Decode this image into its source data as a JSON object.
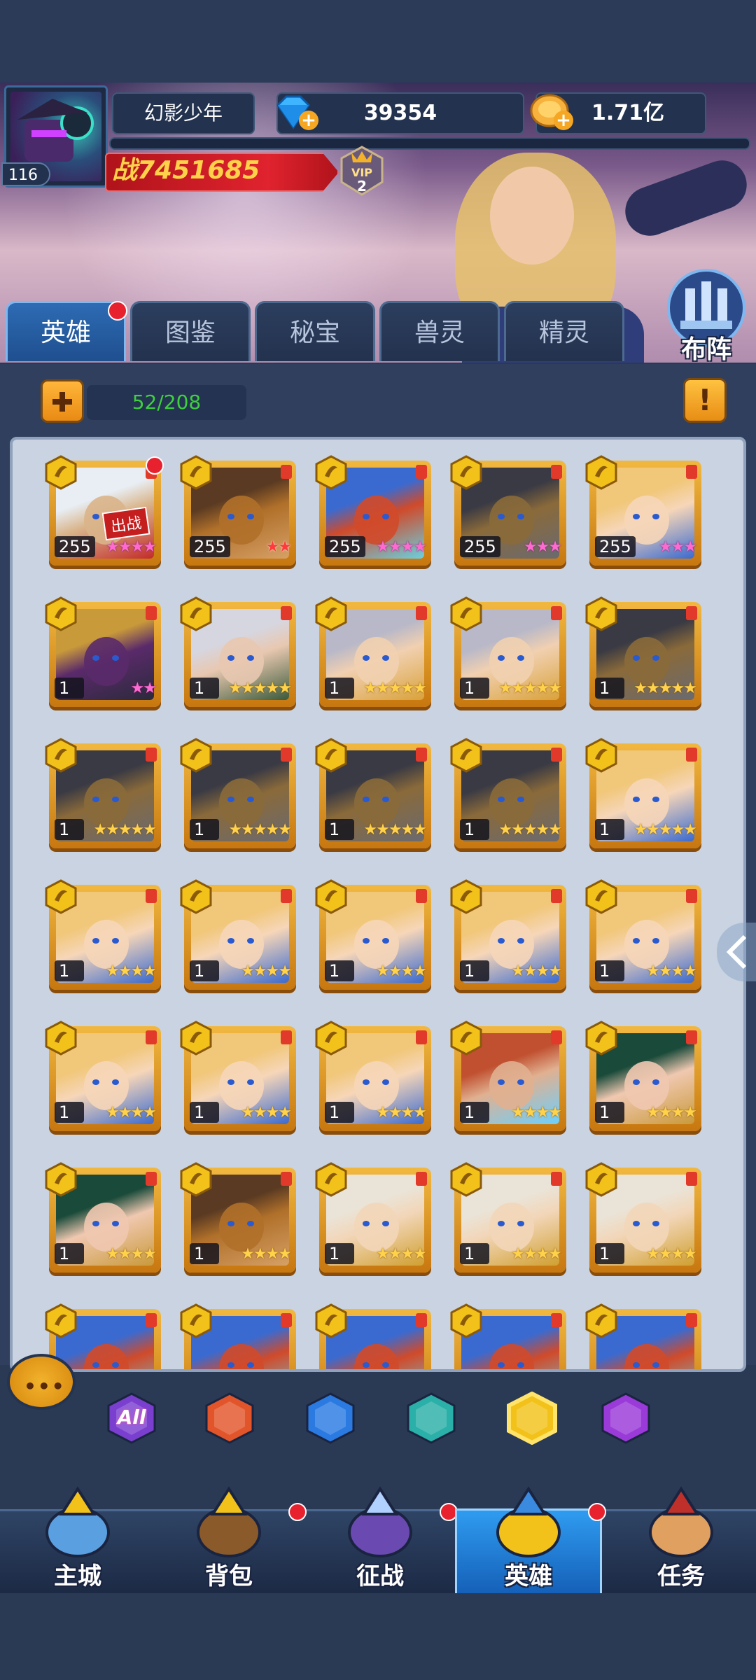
{
  "player": {
    "name": "幻影少年",
    "level": "116",
    "diamonds": "39354",
    "gold": "1.71亿",
    "power": "战7451685",
    "vip": "2"
  },
  "lineup_button": "布阵",
  "tabs": [
    {
      "label": "英雄",
      "active": true,
      "dot": true
    },
    {
      "label": "图鉴",
      "active": false
    },
    {
      "label": "秘宝",
      "active": false
    },
    {
      "label": "兽灵",
      "active": false
    },
    {
      "label": "精灵",
      "active": false
    }
  ],
  "hero_count": "52/208",
  "heroes": [
    {
      "level": "255",
      "stars": "★★★★",
      "star_color": "pink",
      "deployed": true,
      "deploy_label": "出战",
      "dot": true,
      "art": "white-hair"
    },
    {
      "level": "255",
      "stars": "★★",
      "star_color": "red",
      "art": "hooded-brown"
    },
    {
      "level": "255",
      "stars": "★★★★",
      "star_color": "pink",
      "art": "blue-troll"
    },
    {
      "level": "255",
      "stars": "★★★",
      "star_color": "pink",
      "art": "dark-hood"
    },
    {
      "level": "255",
      "stars": "★★★",
      "star_color": "pink",
      "art": "blonde-girl"
    },
    {
      "level": "1",
      "stars": "★★",
      "star_color": "pink",
      "art": "gold-mask"
    },
    {
      "level": "1",
      "stars": "★★★★★",
      "star_color": "gold",
      "art": "silver-hair"
    },
    {
      "level": "1",
      "stars": "★★★★★",
      "star_color": "gold",
      "art": "helmet-girl"
    },
    {
      "level": "1",
      "stars": "★★★★★",
      "star_color": "gold",
      "art": "helmet-girl"
    },
    {
      "level": "1",
      "stars": "★★★★★",
      "star_color": "gold",
      "art": "dark-hood"
    },
    {
      "level": "1",
      "stars": "★★★★★",
      "star_color": "gold",
      "art": "dark-hood"
    },
    {
      "level": "1",
      "stars": "★★★★★",
      "star_color": "gold",
      "art": "dark-hood"
    },
    {
      "level": "1",
      "stars": "★★★★★",
      "star_color": "gold",
      "art": "dark-hood"
    },
    {
      "level": "1",
      "stars": "★★★★★",
      "star_color": "gold",
      "art": "dark-hood"
    },
    {
      "level": "1",
      "stars": "★★★★★",
      "star_color": "gold",
      "art": "blonde-girl"
    },
    {
      "level": "1",
      "stars": "★★★★",
      "star_color": "gold",
      "art": "blonde-girl"
    },
    {
      "level": "1",
      "stars": "★★★★",
      "star_color": "gold",
      "art": "blonde-girl"
    },
    {
      "level": "1",
      "stars": "★★★★",
      "star_color": "gold",
      "art": "blonde-girl"
    },
    {
      "level": "1",
      "stars": "★★★★",
      "star_color": "gold",
      "art": "blonde-girl"
    },
    {
      "level": "1",
      "stars": "★★★★",
      "star_color": "gold",
      "art": "blonde-girl"
    },
    {
      "level": "1",
      "stars": "★★★★",
      "star_color": "gold",
      "art": "blonde-girl"
    },
    {
      "level": "1",
      "stars": "★★★★",
      "star_color": "gold",
      "art": "blonde-girl"
    },
    {
      "level": "1",
      "stars": "★★★★",
      "star_color": "gold",
      "art": "blonde-girl"
    },
    {
      "level": "1",
      "stars": "★★★★",
      "star_color": "gold",
      "art": "bearded-man"
    },
    {
      "level": "1",
      "stars": "★★★★",
      "star_color": "gold",
      "art": "green-hair"
    },
    {
      "level": "1",
      "stars": "★★★★",
      "star_color": "gold",
      "art": "green-hair"
    },
    {
      "level": "1",
      "stars": "★★★★",
      "star_color": "gold",
      "art": "hooded-brown"
    },
    {
      "level": "1",
      "stars": "★★★★",
      "star_color": "gold",
      "art": "white-knight"
    },
    {
      "level": "1",
      "stars": "★★★★",
      "star_color": "gold",
      "art": "white-knight"
    },
    {
      "level": "1",
      "stars": "★★★★",
      "star_color": "gold",
      "art": "white-knight"
    },
    {
      "level": "",
      "stars": "",
      "star_color": "gold",
      "art": "blue-troll"
    },
    {
      "level": "",
      "stars": "",
      "star_color": "gold",
      "art": "blue-troll"
    },
    {
      "level": "",
      "stars": "",
      "star_color": "gold",
      "art": "blue-troll"
    },
    {
      "level": "",
      "stars": "",
      "star_color": "gold",
      "art": "blue-troll"
    },
    {
      "level": "",
      "stars": "",
      "star_color": "gold",
      "art": "blue-troll"
    }
  ],
  "filters": [
    {
      "name": "all-filter-icon",
      "label": "All",
      "color": "#7b3fd0"
    },
    {
      "name": "fire-faction-icon",
      "label": "",
      "color": "#e2552a"
    },
    {
      "name": "water-faction-icon",
      "label": "",
      "color": "#2a7ae2"
    },
    {
      "name": "death-faction-icon",
      "label": "",
      "color": "#2ab0a8"
    },
    {
      "name": "light-faction-icon",
      "label": "",
      "color": "#f2c21a",
      "selected": true
    },
    {
      "name": "dark-faction-icon",
      "label": "",
      "color": "#9a3ad8"
    }
  ],
  "nav": [
    {
      "label": "主城",
      "dot": false,
      "active": false
    },
    {
      "label": "背包",
      "dot": true,
      "active": false
    },
    {
      "label": "征战",
      "dot": true,
      "active": false
    },
    {
      "label": "英雄",
      "dot": true,
      "active": true
    },
    {
      "label": "任务",
      "dot": false,
      "active": false
    }
  ],
  "colors": {
    "accent": "#2f9cf0",
    "gold": "#f1b840",
    "power": "#e0232e",
    "count_text": "#3fcf3f"
  }
}
